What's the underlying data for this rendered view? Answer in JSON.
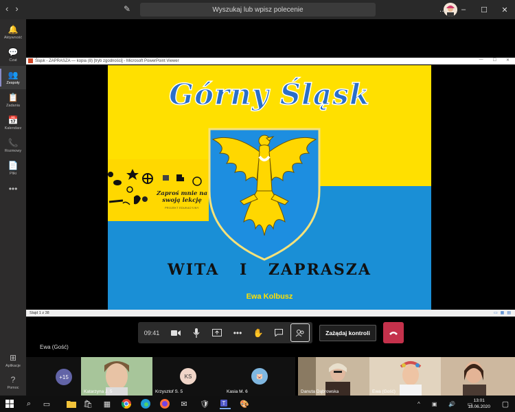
{
  "titlebar": {
    "search_placeholder": "Wyszukaj lub wpisz polecenie",
    "back_icon": "chevron-left",
    "forward_icon": "chevron-right",
    "compose_icon": "compose-icon",
    "minimize": "–",
    "maximize": "☐",
    "close": "✕",
    "more": "…"
  },
  "rail": {
    "items": [
      {
        "label": "Aktywność",
        "icon": "🔔"
      },
      {
        "label": "Czat",
        "icon": "💬"
      },
      {
        "label": "Zespoły",
        "icon": "👥"
      },
      {
        "label": "Zadania",
        "icon": "📋"
      },
      {
        "label": "Kalendarz",
        "icon": "📅"
      },
      {
        "label": "Rozmowy",
        "icon": "📞"
      },
      {
        "label": "Pliki",
        "icon": "📄"
      },
      {
        "label": "",
        "icon": "•••"
      }
    ],
    "bottom": [
      {
        "label": "Aplikacje",
        "icon": "⊞"
      },
      {
        "label": "Pomoc",
        "icon": "?"
      }
    ]
  },
  "ppt": {
    "window_title": "Śląsk - ZAPRASZA — kopia (8) [tryb zgodności] - Microsoft PowerPoint Viewer",
    "status": "Slajd 1 z 38",
    "slide": {
      "title": "Górny Śląsk",
      "promo_text": "Zaproś mnie na swoją lekcję",
      "promo_sub": "PROJEKT EDUKACYJNY",
      "subtitle": "WITA I ZAPRASZA",
      "author": "Ewa Kolbusz",
      "colors": {
        "yellow": "#ffe000",
        "blue": "#1a8fd6",
        "title": "#2a6fc9"
      }
    }
  },
  "toolbar": {
    "time": "09:41",
    "buttons": [
      "camera-icon",
      "mic-icon",
      "share-icon",
      "more-icon",
      "raise-hand-icon",
      "chat-icon",
      "participants-icon"
    ],
    "control_label": "Zażądaj kontroli",
    "hangup_icon": "phone-hangup"
  },
  "guest_label": "Ewa (Gość)",
  "participants": [
    {
      "name": "",
      "badge": "+15"
    },
    {
      "name": "Katarzyna J. 5"
    },
    {
      "name": "Krzysztof S. 5",
      "badge": "KS"
    },
    {
      "name": "Kasia M. 6"
    },
    {
      "name": "Danuta Dąbrowska"
    },
    {
      "name": "Ewa (Gość)"
    },
    {
      "name": ""
    }
  ],
  "taskbar": {
    "time": "13:01",
    "date": "18.06.2020"
  }
}
